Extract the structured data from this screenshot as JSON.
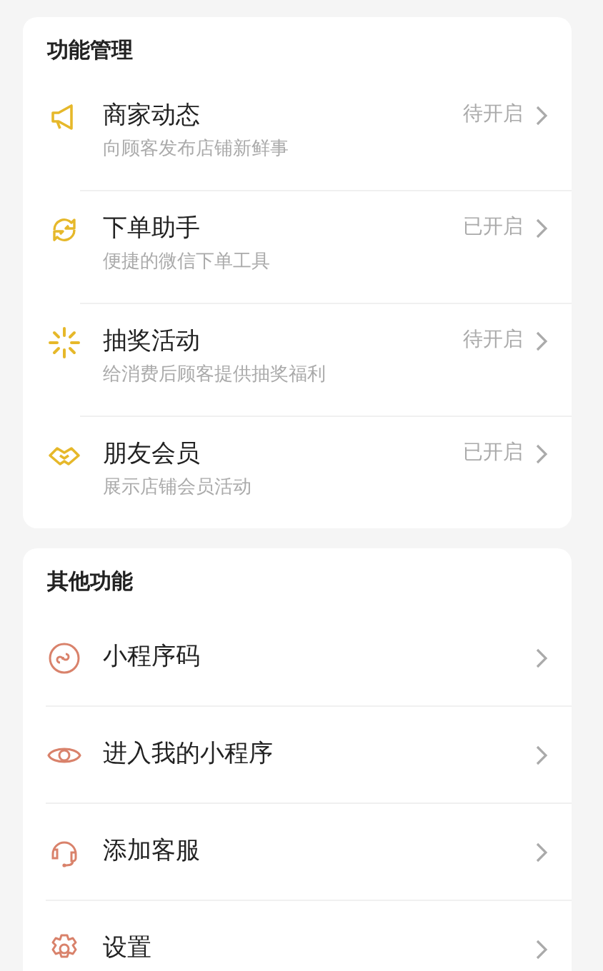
{
  "sections": [
    {
      "title": "功能管理",
      "items": [
        {
          "name": "商家动态",
          "description": "向顾客发布店铺新鲜事",
          "status": "待开启"
        },
        {
          "name": "下单助手",
          "description": "便捷的微信下单工具",
          "status": "已开启"
        },
        {
          "name": "抽奖活动",
          "description": "给消费后顾客提供抽奖福利",
          "status": "待开启"
        },
        {
          "name": "朋友会员",
          "description": "展示店铺会员活动",
          "status": "已开启"
        }
      ]
    },
    {
      "title": "其他功能",
      "items": [
        {
          "name": "小程序码"
        },
        {
          "name": "进入我的小程序"
        },
        {
          "name": "添加客服"
        },
        {
          "name": "设置"
        }
      ]
    }
  ]
}
